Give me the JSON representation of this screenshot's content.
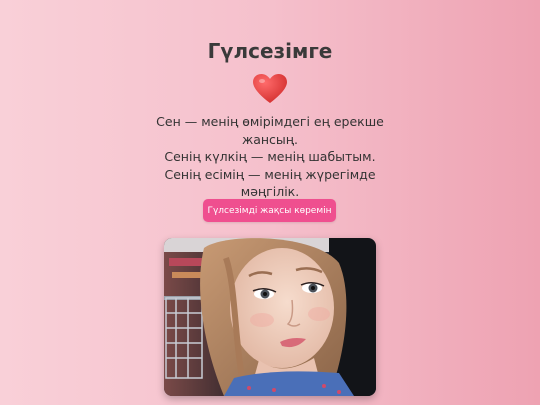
{
  "page": {
    "title": "Гүлсезімге",
    "heart_icon": "red-heart-emoji",
    "message_lines": [
      "Сен — менің өмірімдегі ең ерекше",
      "жансың.",
      "Сенің күлкің — менің шабытым.",
      "Сенің есімің — менің жүрегімде мәңгілік."
    ],
    "button_label": "Гүлсезімді жақсы көремін",
    "photo_subject": "portrait-photo-of-girl"
  },
  "colors": {
    "background_left": "#f9d0d8",
    "background_right": "#eea2b2",
    "button": "#ef4f8f",
    "heart": "#e53935",
    "text": "#333333"
  }
}
